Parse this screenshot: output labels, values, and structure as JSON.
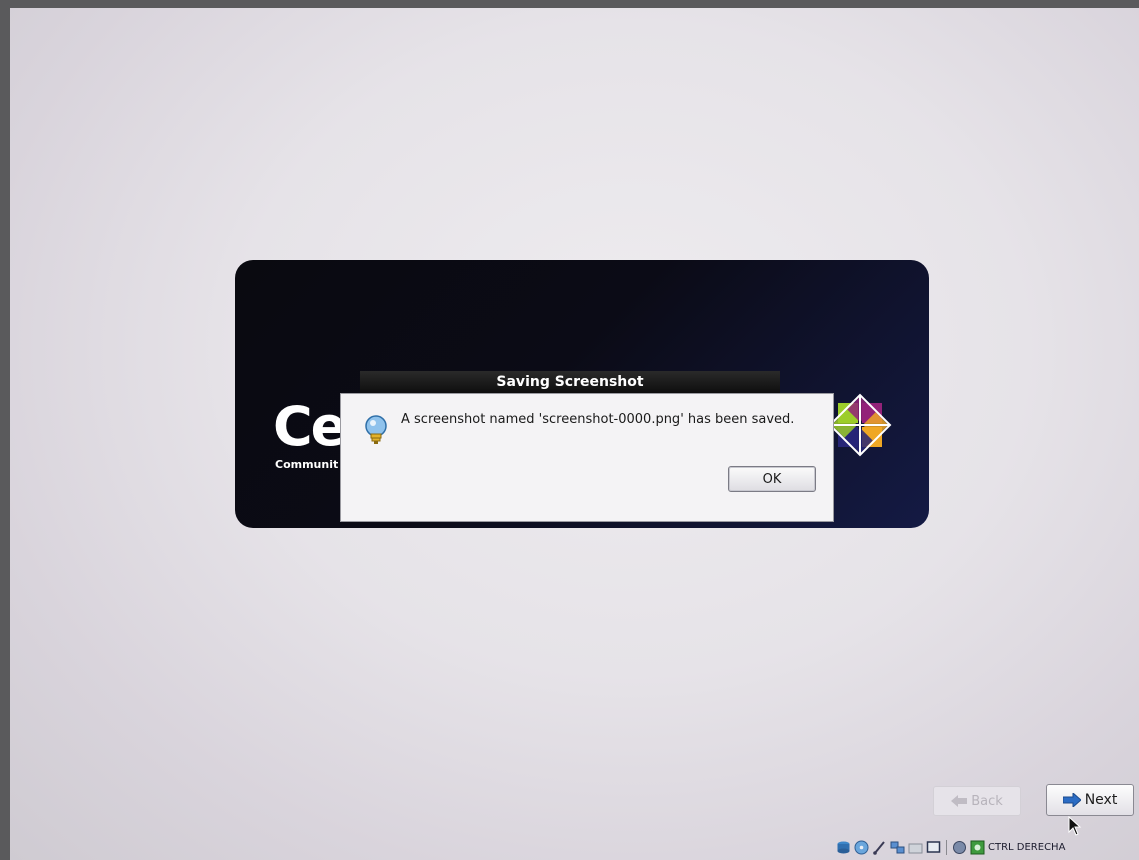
{
  "banner": {
    "logo_text": "Ce",
    "tagline": "Communit"
  },
  "dialog": {
    "title": "Saving Screenshot",
    "message": "A screenshot named 'screenshot-0000.png' has been saved.",
    "ok_label": "OK",
    "icon": "info-lightbulb-icon"
  },
  "nav": {
    "back_label": "Back",
    "next_label": "Next"
  },
  "statusbar": {
    "host_key": "CTRL DERECHA",
    "icons": [
      "hard-disk-icon",
      "optical-drive-icon",
      "usb-icon",
      "network-icon",
      "shared-folders-icon",
      "display-icon",
      "recording-icon",
      "mouse-integration-icon"
    ]
  },
  "colors": {
    "banner_bg": "#0b0b16",
    "dialog_title_bg": "#1a1a1a",
    "next_arrow": "#2b6cc4"
  }
}
